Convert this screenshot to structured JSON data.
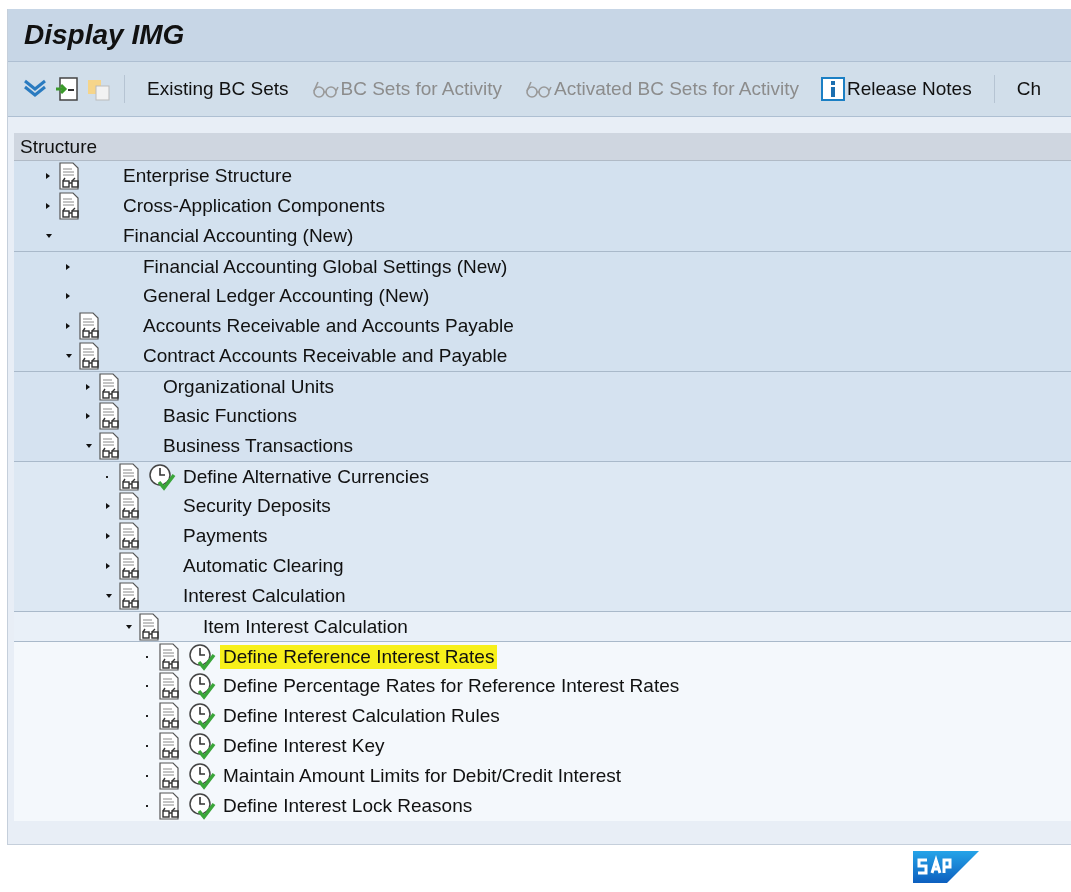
{
  "window": {
    "title": "Display IMG"
  },
  "toolbar": {
    "buttons": [
      {
        "label": "Existing BC Sets",
        "disabled": false,
        "kind": "text"
      },
      {
        "label": "BC Sets for Activity",
        "disabled": true,
        "kind": "glasses"
      },
      {
        "label": "Activated BC Sets for Activity",
        "disabled": true,
        "kind": "glasses"
      },
      {
        "label": "Release Notes",
        "disabled": false,
        "kind": "info"
      },
      {
        "label": "Ch",
        "disabled": false,
        "kind": "text"
      }
    ]
  },
  "tree": {
    "header": "Structure",
    "nodes": [
      {
        "label": "Enterprise Structure",
        "kind": "folder",
        "expanded": false,
        "document": true
      },
      {
        "label": "Cross-Application Components",
        "kind": "folder",
        "expanded": false,
        "document": true
      },
      {
        "label": "Financial Accounting (New)",
        "kind": "folder",
        "expanded": true,
        "document": false,
        "children": [
          {
            "label": "Financial Accounting Global Settings (New)",
            "kind": "folder",
            "expanded": false,
            "document": false
          },
          {
            "label": "General Ledger Accounting (New)",
            "kind": "folder",
            "expanded": false,
            "document": false
          },
          {
            "label": "Accounts Receivable and Accounts Payable",
            "kind": "folder",
            "expanded": false,
            "document": true
          },
          {
            "label": "Contract Accounts Receivable and Payable",
            "kind": "folder",
            "expanded": true,
            "document": true,
            "children": [
              {
                "label": "Organizational Units",
                "kind": "folder",
                "expanded": false,
                "document": true
              },
              {
                "label": "Basic Functions",
                "kind": "folder",
                "expanded": false,
                "document": true
              },
              {
                "label": "Business Transactions",
                "kind": "folder",
                "expanded": true,
                "document": true,
                "children": [
                  {
                    "label": "Define Alternative Currencies",
                    "kind": "activity",
                    "document": true,
                    "highlighted": false
                  },
                  {
                    "label": "Security Deposits",
                    "kind": "folder",
                    "expanded": false,
                    "document": true
                  },
                  {
                    "label": "Payments",
                    "kind": "folder",
                    "expanded": false,
                    "document": true
                  },
                  {
                    "label": "Automatic Clearing",
                    "kind": "folder",
                    "expanded": false,
                    "document": true
                  },
                  {
                    "label": "Interest Calculation",
                    "kind": "folder",
                    "expanded": true,
                    "document": true,
                    "children": [
                      {
                        "label": "Item Interest Calculation",
                        "kind": "folder",
                        "expanded": true,
                        "document": true,
                        "children": [
                          {
                            "label": "Define Reference Interest Rates",
                            "kind": "activity",
                            "document": true,
                            "highlighted": true
                          },
                          {
                            "label": "Define Percentage Rates for Reference Interest Rates",
                            "kind": "activity",
                            "document": true,
                            "highlighted": false
                          },
                          {
                            "label": "Define Interest Calculation Rules",
                            "kind": "activity",
                            "document": true,
                            "highlighted": false
                          },
                          {
                            "label": "Define Interest Key",
                            "kind": "activity",
                            "document": true,
                            "highlighted": false
                          },
                          {
                            "label": "Maintain Amount Limits for Debit/Credit Interest",
                            "kind": "activity",
                            "document": true,
                            "highlighted": false
                          },
                          {
                            "label": "Define Interest Lock Reasons",
                            "kind": "activity",
                            "document": true,
                            "highlighted": false
                          }
                        ]
                      }
                    ]
                  }
                ]
              }
            ]
          }
        ]
      }
    ]
  }
}
